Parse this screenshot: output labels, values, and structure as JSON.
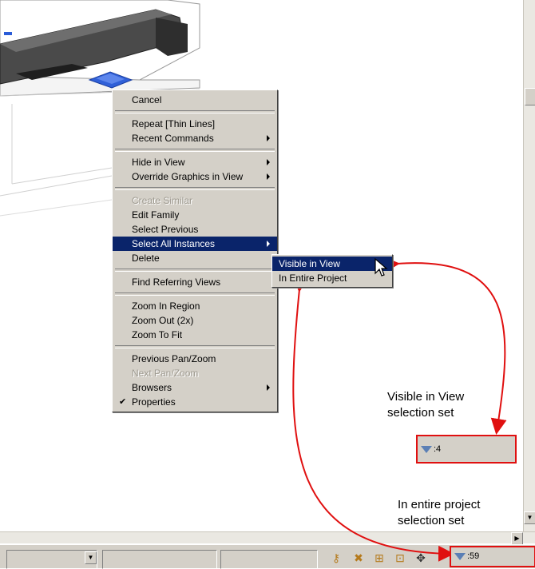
{
  "context_menu": {
    "items": [
      {
        "label": "Cancel"
      },
      {
        "sep": true
      },
      {
        "label": "Repeat [Thin Lines]"
      },
      {
        "label": "Recent Commands",
        "submenu": true
      },
      {
        "sep": true
      },
      {
        "label": "Hide in View",
        "submenu": true
      },
      {
        "label": "Override Graphics in View",
        "submenu": true
      },
      {
        "sep": true
      },
      {
        "label": "Create Similar",
        "disabled": true
      },
      {
        "label": "Edit Family"
      },
      {
        "label": "Select Previous"
      },
      {
        "label": "Select All Instances",
        "submenu": true,
        "highlighted": true
      },
      {
        "label": "Delete"
      },
      {
        "sep": true
      },
      {
        "label": "Find Referring Views"
      },
      {
        "sep": true
      },
      {
        "label": "Zoom In Region"
      },
      {
        "label": "Zoom Out (2x)"
      },
      {
        "label": "Zoom To Fit"
      },
      {
        "sep": true
      },
      {
        "label": "Previous Pan/Zoom"
      },
      {
        "label": "Next Pan/Zoom",
        "disabled": true
      },
      {
        "label": "Browsers",
        "submenu": true
      },
      {
        "label": "Properties",
        "checked": true
      }
    ]
  },
  "submenu": {
    "items": [
      {
        "label": "Visible in View",
        "highlighted": true
      },
      {
        "label": "In Entire Project"
      }
    ]
  },
  "annotations": {
    "visible_in_view_line1": "Visible in View",
    "visible_in_view_line2": "selection set",
    "entire_project_line1": "In entire project",
    "entire_project_line2": "selection set"
  },
  "selection_counts": {
    "visible_in_view": ":4",
    "entire_project": ":59"
  },
  "colors": {
    "menu_bg": "#d4d0c8",
    "highlight": "#0a246a",
    "annotation_red": "#e01010"
  }
}
